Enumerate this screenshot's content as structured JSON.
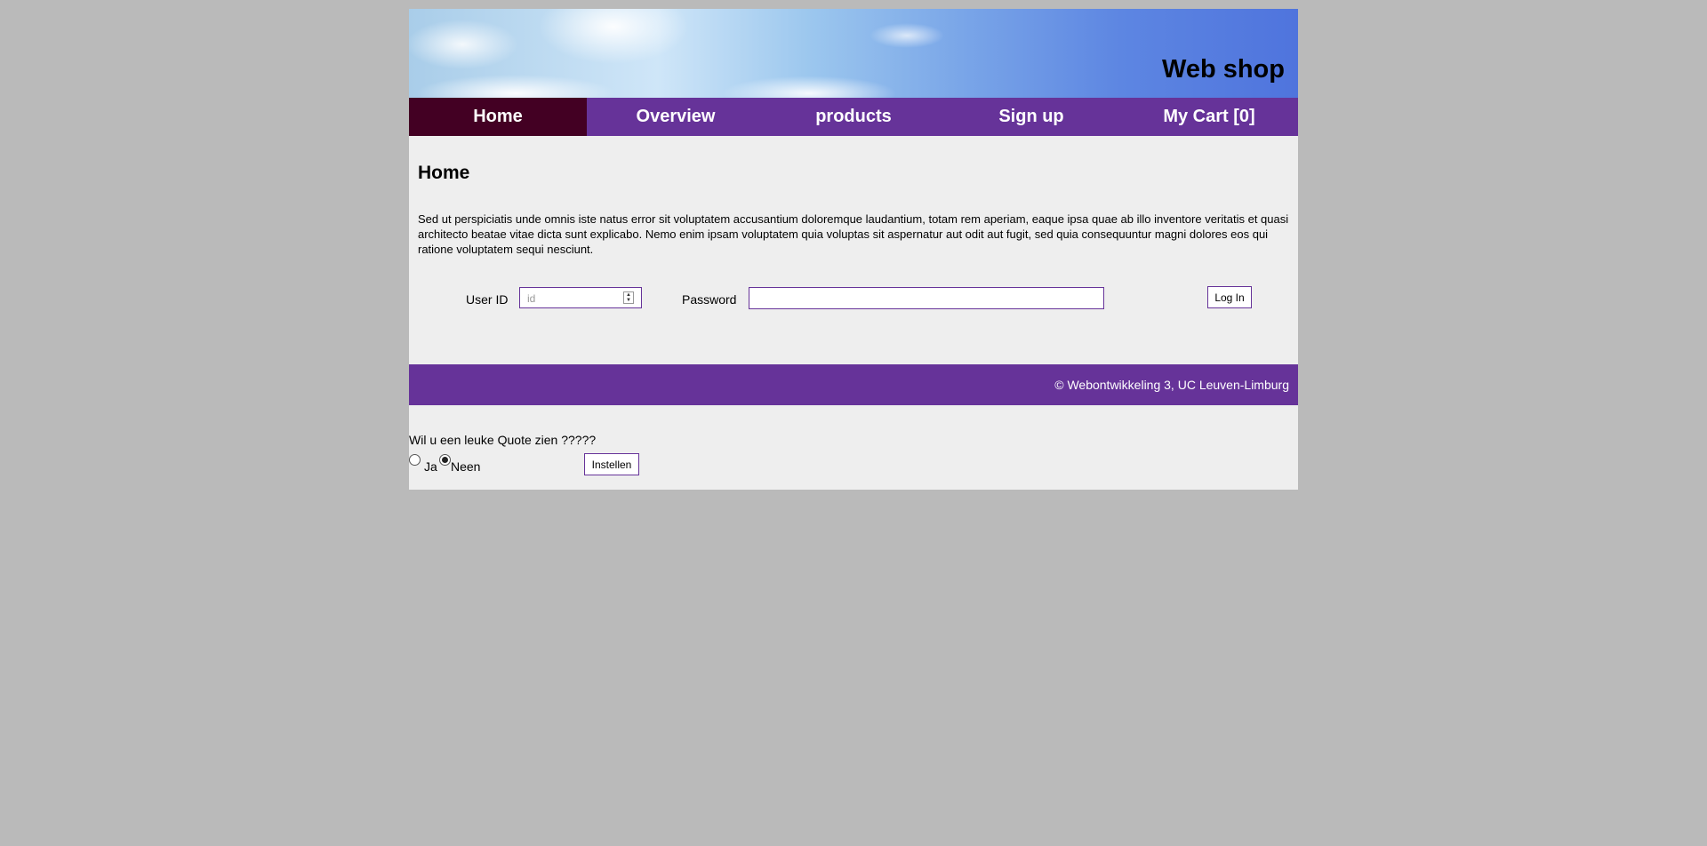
{
  "header": {
    "site_title": "Web shop"
  },
  "nav": {
    "items": [
      {
        "label": "Home",
        "active": true
      },
      {
        "label": "Overview",
        "active": false
      },
      {
        "label": "products",
        "active": false
      },
      {
        "label": "Sign up",
        "active": false
      },
      {
        "label": "My Cart [0]",
        "active": false
      }
    ]
  },
  "main": {
    "page_title": "Home",
    "intro": "Sed ut perspiciatis unde omnis iste natus error sit voluptatem accusantium doloremque laudantium, totam rem aperiam, eaque ipsa quae ab illo inventore veritatis et quasi architecto beatae vitae dicta sunt explicabo. Nemo enim ipsam voluptatem quia voluptas sit aspernatur aut odit aut fugit, sed quia consequuntur magni dolores eos qui ratione voluptatem sequi nesciunt.",
    "login": {
      "userid_label": "User ID",
      "userid_placeholder": "id",
      "userid_value": "",
      "password_label": "Password",
      "password_value": "",
      "login_button": "Log In"
    }
  },
  "footer": {
    "text": "© Webontwikkeling 3, UC Leuven-Limburg"
  },
  "quote": {
    "question": "Wil u een leuke Quote zien ?????",
    "options": [
      {
        "label": "Ja",
        "checked": false
      },
      {
        "label": "Neen",
        "checked": true
      }
    ],
    "submit_label": "Instellen"
  },
  "colors": {
    "page_background": "#bababa",
    "content_background": "#eeeeee",
    "nav_background": "#663399",
    "nav_active": "#430023",
    "footer_background": "#663399",
    "input_border": "#663399"
  },
  "icons": {
    "stepper": "spin-stepper-icon"
  }
}
